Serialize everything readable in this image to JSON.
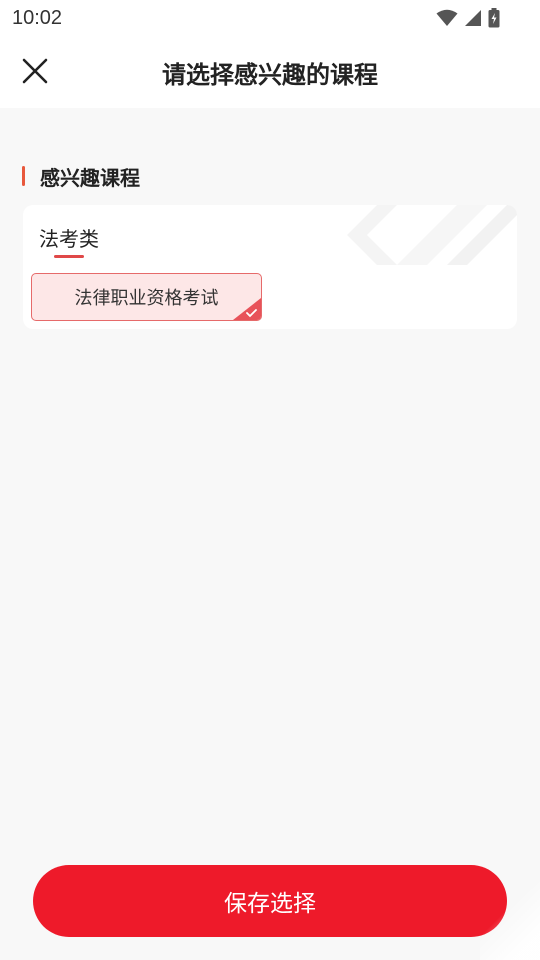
{
  "status_bar": {
    "time": "10:02",
    "icons": [
      "wifi-icon",
      "signal-icon",
      "battery-icon"
    ]
  },
  "header": {
    "close_icon": "close-icon",
    "title": "请选择感兴趣的课程"
  },
  "section": {
    "title": "感兴趣课程"
  },
  "categories": [
    {
      "name": "法考类",
      "courses": [
        {
          "label": "法律职业资格考试",
          "selected": true
        }
      ]
    }
  ],
  "footer": {
    "save_label": "保存选择"
  },
  "colors": {
    "accent": "#ee1a2a",
    "section_accent": "#e8583c",
    "chip_bg": "#fde7e7",
    "chip_border": "#e66a6a",
    "page_bg": "#f8f8f8"
  }
}
